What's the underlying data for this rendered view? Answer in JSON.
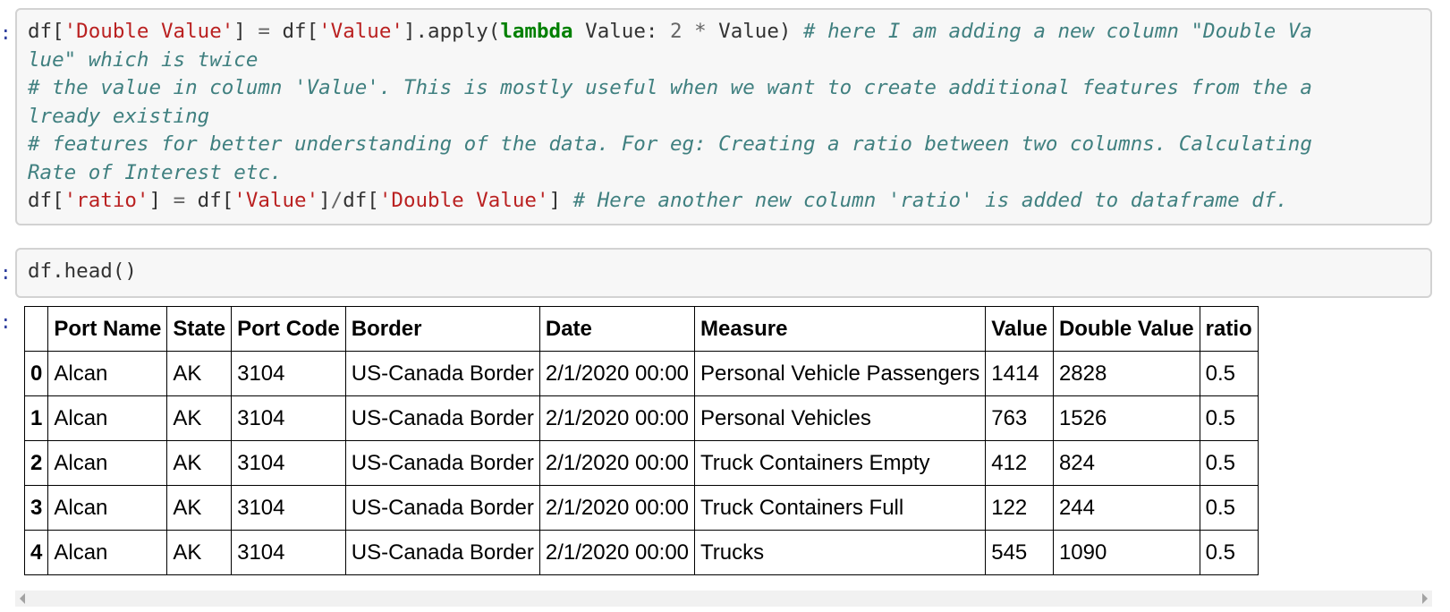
{
  "prompts": [
    ":",
    ":",
    ":"
  ],
  "code_cell_1": {
    "line1_a": "df[",
    "line1_s1": "'Double Value'",
    "line1_b": "] ",
    "line1_eq": "=",
    "line1_c": " df[",
    "line1_s2": "'Value'",
    "line1_d": "].apply(",
    "line1_kw": "lambda",
    "line1_e": " Value: ",
    "line1_num": "2",
    "line1_f": " ",
    "line1_mul": "*",
    "line1_g": " Value) ",
    "line1_comment": "# here I am adding a new column \"Double Va",
    "line2_comment": "lue\" which is twice",
    "line3_comment": "# the value in column 'Value'. This is mostly useful when we want to create additional features from the a",
    "line4_comment": "lready existing",
    "line5_comment": "# features for better understanding of the data. For eg: Creating a ratio between two columns. Calculating",
    "line6_comment": "Rate of Interest etc.",
    "line7_a": "df[",
    "line7_s1": "'ratio'",
    "line7_b": "] ",
    "line7_eq": "=",
    "line7_c": " df[",
    "line7_s2": "'Value'",
    "line7_d": "]",
    "line7_div": "/",
    "line7_e": "df[",
    "line7_s3": "'Double Value'",
    "line7_f": "] ",
    "line7_comment": "# Here another new column 'ratio' is added to dataframe df."
  },
  "code_cell_2": {
    "code": "df.head()"
  },
  "dataframe": {
    "headers": [
      "",
      "Port Name",
      "State",
      "Port Code",
      "Border",
      "Date",
      "Measure",
      "Value",
      "Double Value",
      "ratio"
    ],
    "rows": [
      [
        "0",
        "Alcan",
        "AK",
        "3104",
        "US-Canada Border",
        "2/1/2020 00:00",
        "Personal Vehicle Passengers",
        "1414",
        "2828",
        "0.5"
      ],
      [
        "1",
        "Alcan",
        "AK",
        "3104",
        "US-Canada Border",
        "2/1/2020 00:00",
        "Personal Vehicles",
        "763",
        "1526",
        "0.5"
      ],
      [
        "2",
        "Alcan",
        "AK",
        "3104",
        "US-Canada Border",
        "2/1/2020 00:00",
        "Truck Containers Empty",
        "412",
        "824",
        "0.5"
      ],
      [
        "3",
        "Alcan",
        "AK",
        "3104",
        "US-Canada Border",
        "2/1/2020 00:00",
        "Truck Containers Full",
        "122",
        "244",
        "0.5"
      ],
      [
        "4",
        "Alcan",
        "AK",
        "3104",
        "US-Canada Border",
        "2/1/2020 00:00",
        "Trucks",
        "545",
        "1090",
        "0.5"
      ]
    ]
  },
  "icons": {
    "scroll_left": "chevron-left-icon",
    "scroll_right": "chevron-right-icon"
  }
}
